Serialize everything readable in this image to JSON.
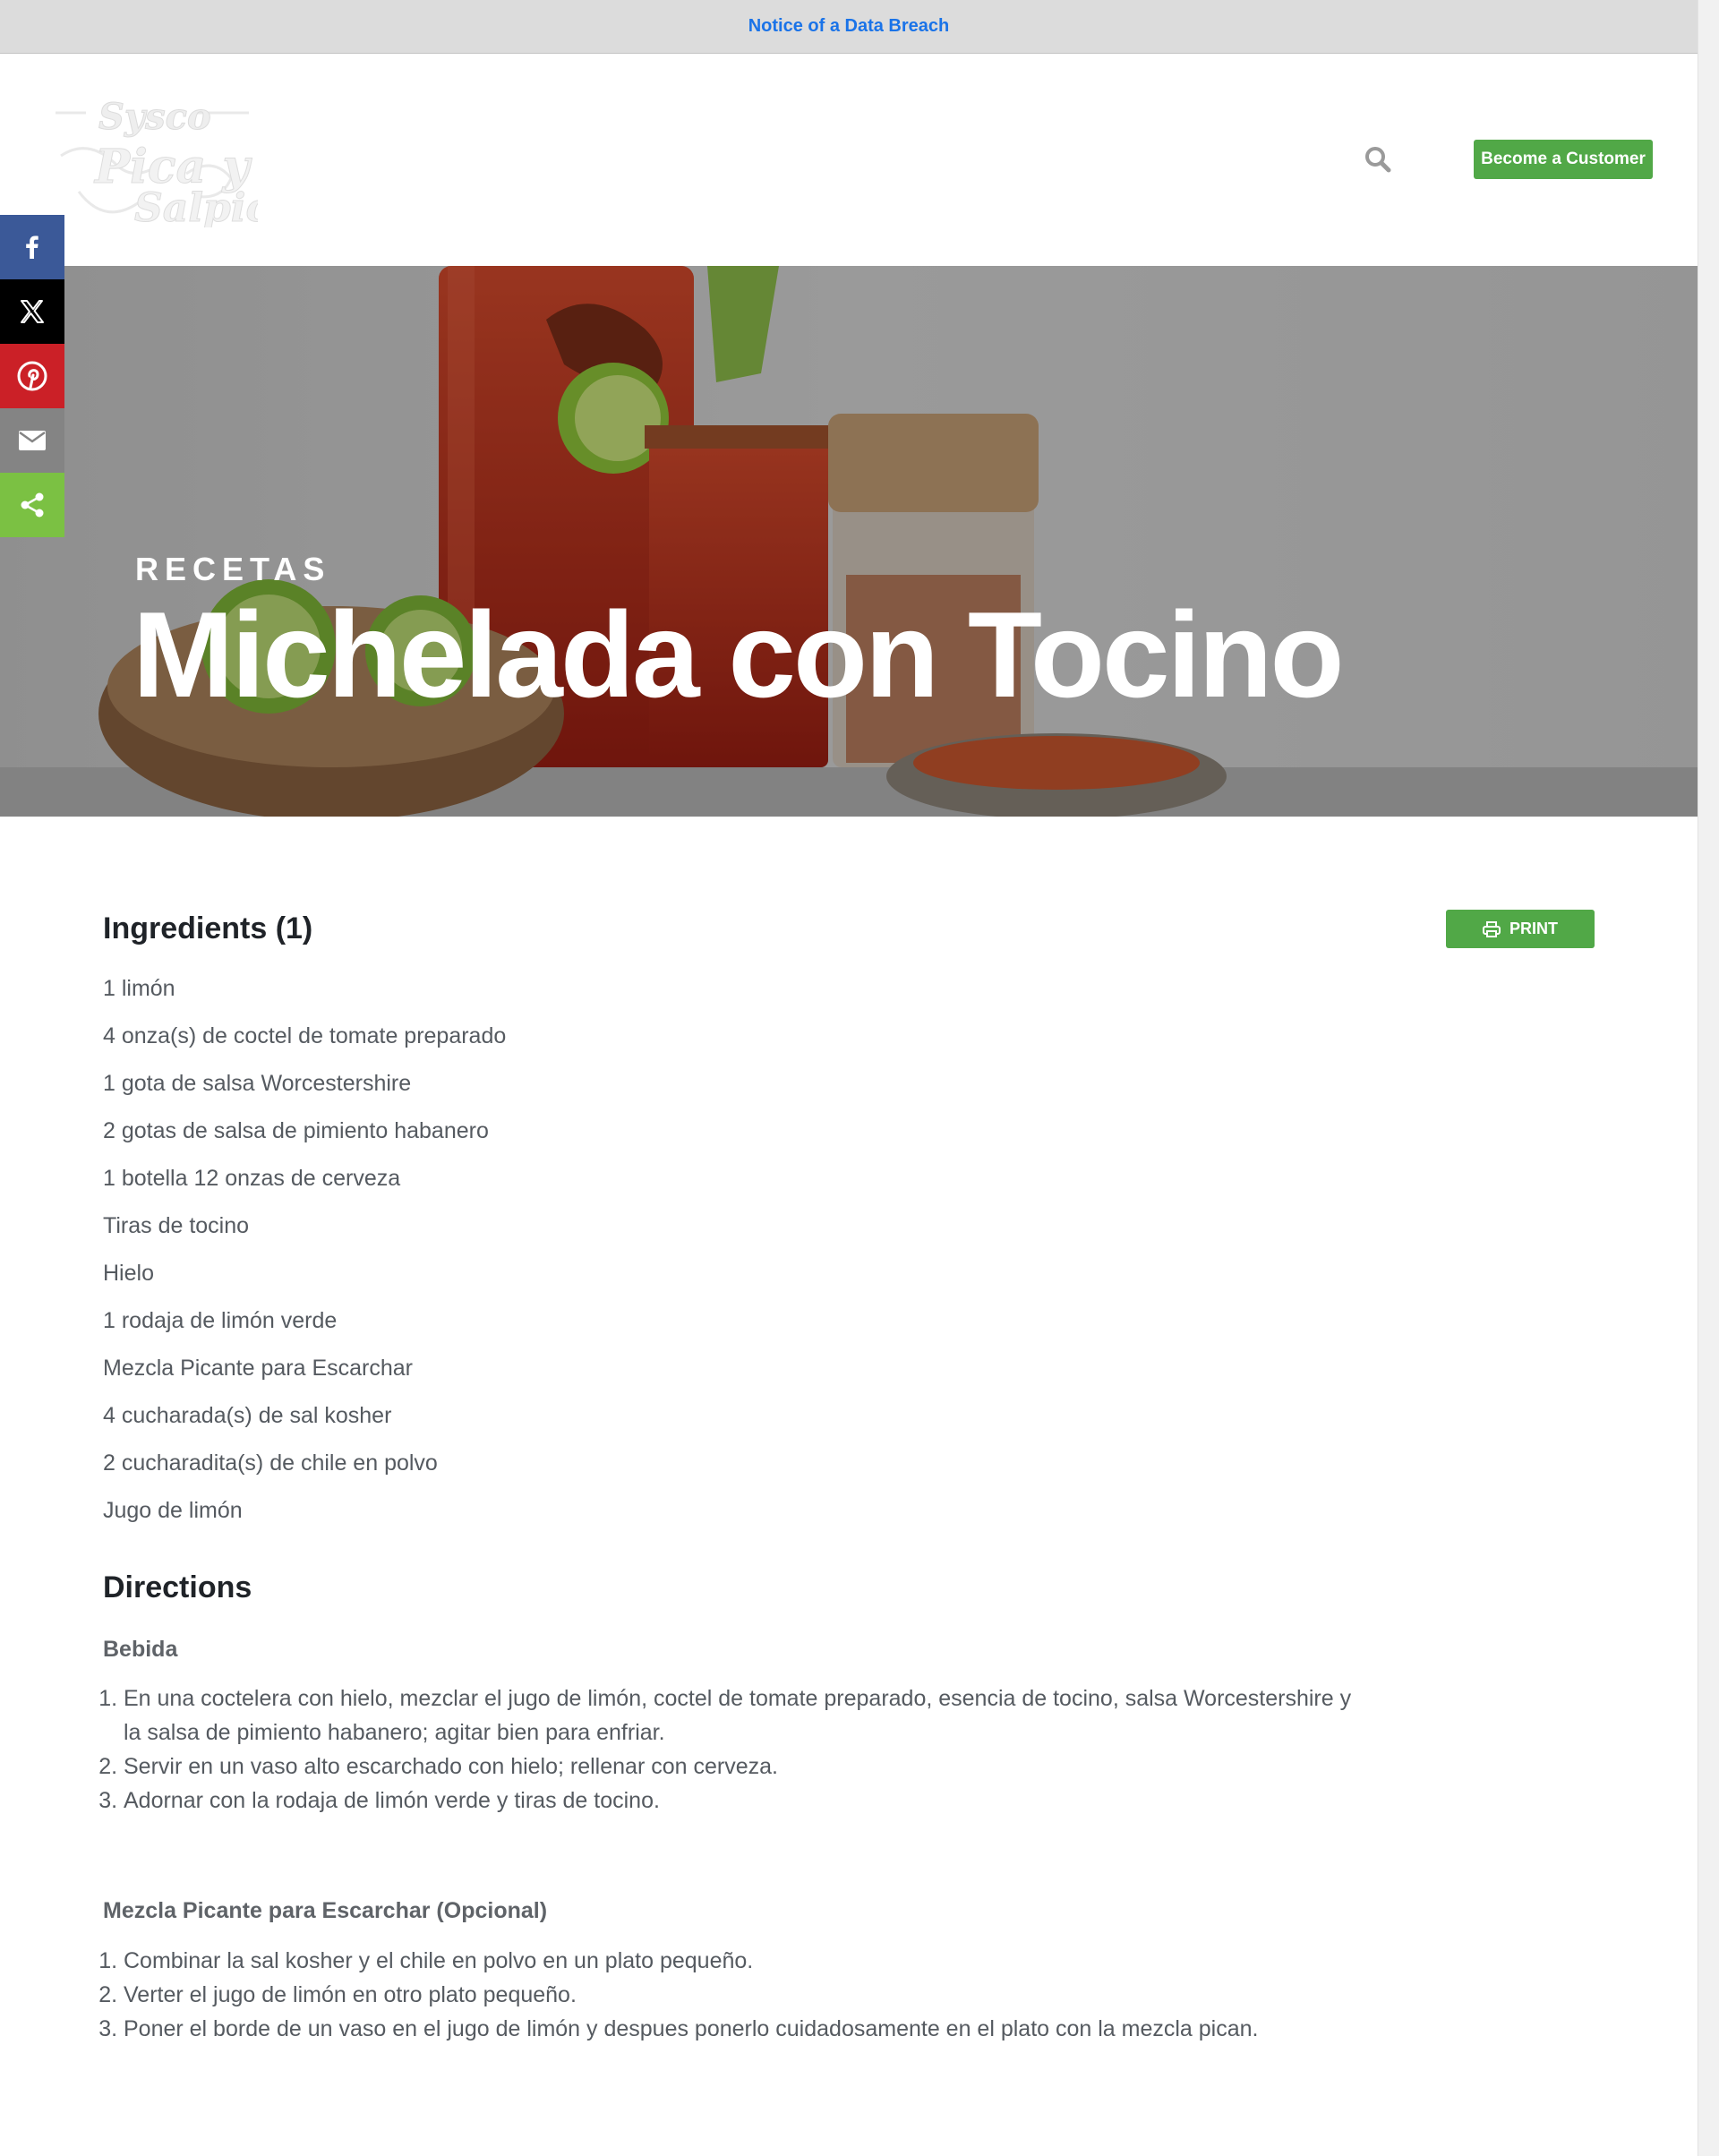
{
  "notice": {
    "text": "Notice of a Data Breach"
  },
  "header": {
    "logo_alt": "Sysco Pica y Salpica",
    "search_icon": "search-icon",
    "cta_label": "Become a Customer"
  },
  "share": {
    "items": [
      "facebook-icon",
      "x-icon",
      "pinterest-icon",
      "email-icon",
      "share-icon"
    ]
  },
  "hero": {
    "eyebrow": "RECETAS",
    "title": "Michelada con Tocino"
  },
  "ingredients": {
    "title": "Ingredients (1)",
    "print_label": "PRINT",
    "items": [
      "1 limón",
      "4 onza(s) de coctel de tomate preparado",
      "1 gota de salsa Worcestershire",
      "2 gotas de salsa de pimiento habanero",
      "1 botella 12 onzas de cerveza",
      "Tiras de tocino",
      "Hielo",
      "1 rodaja de limón verde",
      "Mezcla Picante para Escarchar",
      "4 cucharada(s) de sal kosher",
      "2 cucharadita(s) de chile en polvo",
      "Jugo de limón"
    ]
  },
  "directions": {
    "title": "Directions",
    "sections": [
      {
        "heading": "Bebida",
        "steps": [
          "En una coctelera con hielo, mezclar el jugo de limón, coctel de tomate preparado, esencia de tocino, salsa Worcestershire y la salsa de pimiento habanero; agitar bien para enfriar.",
          "Servir en un vaso alto escarchado con hielo; rellenar con cerveza.",
          "Adornar con la rodaja de limón verde y tiras de tocino."
        ]
      },
      {
        "heading": "Mezcla Picante para Escarchar (Opcional)",
        "steps": [
          "Combinar la sal kosher y el chile en polvo en un plato pequeño.",
          "Verter el jugo de limón en otro plato pequeño.",
          "Poner el borde de un vaso en el jugo de  limón y despues ponerlo cuidadosamente en el plato con la mezcla pican."
        ]
      }
    ]
  },
  "colors": {
    "brand_green": "#51a847",
    "link_blue": "#1a73e8",
    "facebook": "#3b5998",
    "x": "#000000",
    "pinterest": "#cb2027",
    "email": "#848484",
    "share": "#7bc143"
  }
}
